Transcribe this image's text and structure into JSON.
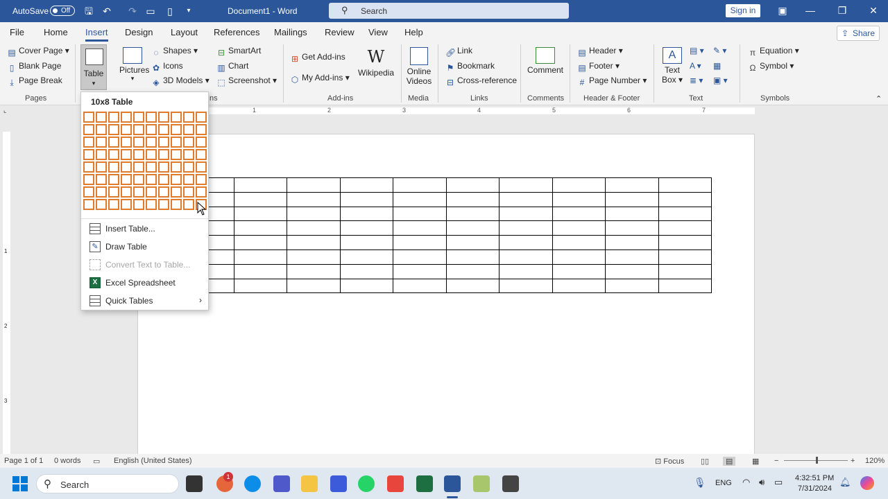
{
  "titlebar": {
    "autosave": "AutoSave",
    "toggle": "Off",
    "doc_title": "Document1  -  Word",
    "search": "Search",
    "signin": "Sign in"
  },
  "tabs": [
    "File",
    "Home",
    "Insert",
    "Design",
    "Layout",
    "References",
    "Mailings",
    "Review",
    "View",
    "Help"
  ],
  "share": "Share",
  "ribbon": {
    "pages": {
      "label": "Pages",
      "items": [
        "Cover Page",
        "Blank Page",
        "Page Break"
      ]
    },
    "tables": {
      "label": "Table"
    },
    "illustrations": {
      "pictures": "Pictures",
      "items": [
        "Shapes",
        "Icons",
        "3D Models"
      ],
      "items2": [
        "SmartArt",
        "Chart",
        "Screenshot"
      ],
      "label_tail": "ns"
    },
    "addins": {
      "label": "Add-ins",
      "items": [
        "Get Add-ins",
        "My Add-ins"
      ],
      "wikipedia": "Wikipedia"
    },
    "media": {
      "label": "Media",
      "online": "Online",
      "videos": "Videos"
    },
    "links": {
      "label": "Links",
      "items": [
        "Link",
        "Bookmark",
        "Cross-reference"
      ]
    },
    "comments": {
      "label": "Comments",
      "comment": "Comment"
    },
    "headerfooter": {
      "label": "Header & Footer",
      "items": [
        "Header",
        "Footer",
        "Page Number"
      ]
    },
    "text": {
      "label": "Text",
      "textbox1": "Text",
      "textbox2": "Box"
    },
    "symbols": {
      "label": "Symbols",
      "items": [
        "Equation",
        "Symbol"
      ]
    }
  },
  "ruler": [
    "1",
    "2",
    "3",
    "4",
    "5",
    "6",
    "7"
  ],
  "vruler": [
    "1",
    "2",
    "3"
  ],
  "table_menu": {
    "grid_title": "10x8 Table",
    "grid_cols": 10,
    "grid_rows": 8,
    "items": [
      {
        "label": "Insert Table...",
        "disabled": false
      },
      {
        "label": "Draw Table",
        "disabled": false
      },
      {
        "label": "Convert Text to Table...",
        "disabled": true
      },
      {
        "label": "Excel Spreadsheet",
        "disabled": false
      },
      {
        "label": "Quick Tables",
        "disabled": false
      }
    ]
  },
  "document_table": {
    "cols": 10,
    "rows": 8
  },
  "status": {
    "page": "Page 1 of 1",
    "words": "0 words",
    "lang": "English (United States)",
    "focus": "Focus",
    "zoom": "120%"
  },
  "taskbar": {
    "search": "Search",
    "badge": "1",
    "lang": "ENG",
    "time": "4:32:51 PM",
    "date": "7/31/2024"
  },
  "colors": {
    "brand": "#2b579a",
    "grid": "#e07b2e"
  }
}
